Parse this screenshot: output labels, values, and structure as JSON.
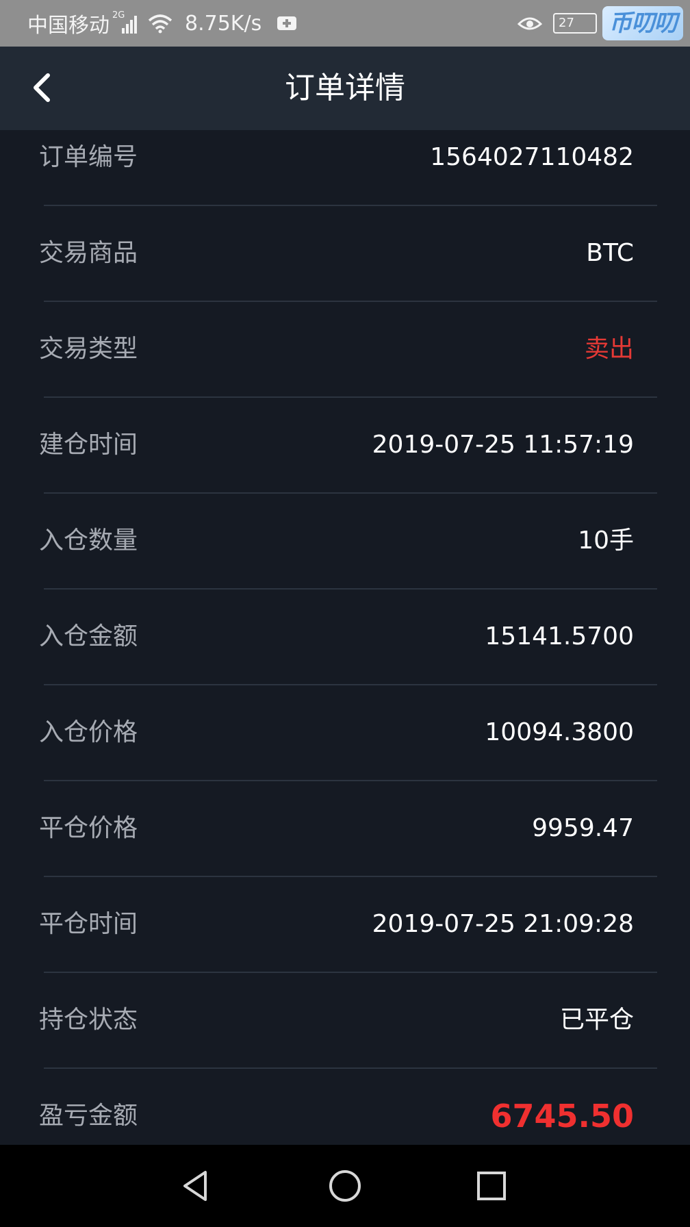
{
  "status_bar": {
    "carrier": "中国移动",
    "network_tag": "2G",
    "speed": "8.75K/s",
    "battery": "27",
    "logo_text": "币叨叨"
  },
  "header": {
    "title": "订单详情"
  },
  "rows": [
    {
      "label": "订单编号",
      "value": "1564027110482"
    },
    {
      "label": "交易商品",
      "value": "BTC"
    },
    {
      "label": "交易类型",
      "value": "卖出"
    },
    {
      "label": "建仓时间",
      "value": "2019-07-25 11:57:19"
    },
    {
      "label": "入仓数量",
      "value": "10手"
    },
    {
      "label": "入仓金额",
      "value": "15141.5700"
    },
    {
      "label": "入仓价格",
      "value": "10094.3800"
    },
    {
      "label": "平仓价格",
      "value": "9959.47"
    },
    {
      "label": "平仓时间",
      "value": "2019-07-25 21:09:28"
    },
    {
      "label": "持仓状态",
      "value": "已平仓"
    },
    {
      "label": "盈亏金额",
      "value": "6745.50"
    }
  ],
  "colors": {
    "status_bar_bg": "#8f8f8f",
    "header_bg": "#222a35",
    "page_bg": "#151a23",
    "label_text": "#a7abb3",
    "value_text": "#ffffff",
    "accent_red": "#e53935",
    "divider": "#2c3440"
  },
  "icons": {
    "back": "chevron-left-icon",
    "signal": "signal-icon",
    "wifi": "wifi-icon",
    "notification": "plus-box-icon",
    "eye": "eye-icon",
    "battery": "battery-icon",
    "nav_back": "triangle-back-icon",
    "nav_home": "circle-home-icon",
    "nav_recent": "square-recent-icon"
  }
}
